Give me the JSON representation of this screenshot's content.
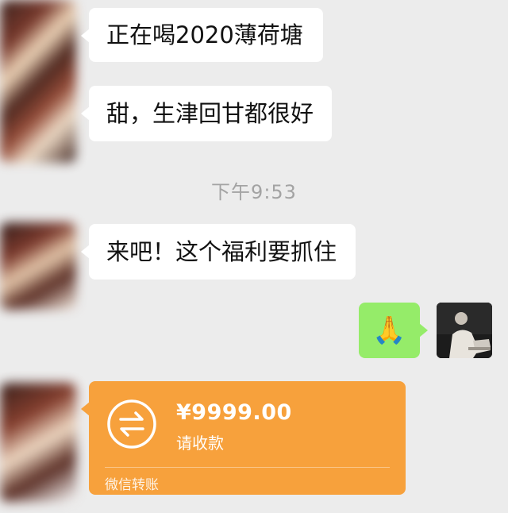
{
  "messages": [
    {
      "text": "正在喝2020薄荷塘"
    },
    {
      "text": "甜，生津回甘都很好"
    },
    {
      "text": "来吧！这个福利要抓住"
    }
  ],
  "timestamp": "下午9:53",
  "sent": {
    "emoji": "🙏",
    "emoji_icon": "praying-hands-icon",
    "bubble_color": "#95ec69"
  },
  "transfer": {
    "amount": "¥9999.00",
    "status": "请收款",
    "footer": "微信转账",
    "icon": "transfer-arrows-icon",
    "color": "#f7a13c"
  }
}
